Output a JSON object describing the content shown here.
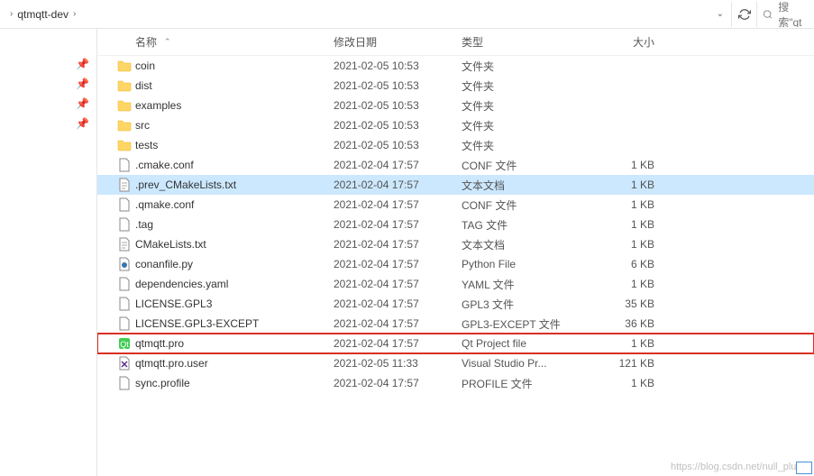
{
  "breadcrumb": {
    "current": "qtmqtt-dev"
  },
  "toolbar": {
    "search_placeholder": "搜索\"qt"
  },
  "columns": {
    "name": "名称",
    "date": "修改日期",
    "type": "类型",
    "size": "大小"
  },
  "files": [
    {
      "icon": "folder",
      "name": "coin",
      "date": "2021-02-05 10:53",
      "type": "文件夹",
      "size": ""
    },
    {
      "icon": "folder",
      "name": "dist",
      "date": "2021-02-05 10:53",
      "type": "文件夹",
      "size": ""
    },
    {
      "icon": "folder",
      "name": "examples",
      "date": "2021-02-05 10:53",
      "type": "文件夹",
      "size": ""
    },
    {
      "icon": "folder",
      "name": "src",
      "date": "2021-02-05 10:53",
      "type": "文件夹",
      "size": ""
    },
    {
      "icon": "folder",
      "name": "tests",
      "date": "2021-02-05 10:53",
      "type": "文件夹",
      "size": ""
    },
    {
      "icon": "file",
      "name": ".cmake.conf",
      "date": "2021-02-04 17:57",
      "type": "CONF 文件",
      "size": "1 KB"
    },
    {
      "icon": "text",
      "name": ".prev_CMakeLists.txt",
      "date": "2021-02-04 17:57",
      "type": "文本文档",
      "size": "1 KB",
      "selected": true
    },
    {
      "icon": "file",
      "name": ".qmake.conf",
      "date": "2021-02-04 17:57",
      "type": "CONF 文件",
      "size": "1 KB"
    },
    {
      "icon": "file",
      "name": ".tag",
      "date": "2021-02-04 17:57",
      "type": "TAG 文件",
      "size": "1 KB"
    },
    {
      "icon": "text",
      "name": "CMakeLists.txt",
      "date": "2021-02-04 17:57",
      "type": "文本文档",
      "size": "1 KB"
    },
    {
      "icon": "python",
      "name": "conanfile.py",
      "date": "2021-02-04 17:57",
      "type": "Python File",
      "size": "6 KB"
    },
    {
      "icon": "file",
      "name": "dependencies.yaml",
      "date": "2021-02-04 17:57",
      "type": "YAML 文件",
      "size": "1 KB"
    },
    {
      "icon": "file",
      "name": "LICENSE.GPL3",
      "date": "2021-02-04 17:57",
      "type": "GPL3 文件",
      "size": "35 KB"
    },
    {
      "icon": "file",
      "name": "LICENSE.GPL3-EXCEPT",
      "date": "2021-02-04 17:57",
      "type": "GPL3-EXCEPT 文件",
      "size": "36 KB"
    },
    {
      "icon": "qt",
      "name": "qtmqtt.pro",
      "date": "2021-02-04 17:57",
      "type": "Qt Project file",
      "size": "1 KB",
      "highlighted": true
    },
    {
      "icon": "vs",
      "name": "qtmqtt.pro.user",
      "date": "2021-02-05 11:33",
      "type": "Visual Studio Pr...",
      "size": "121 KB"
    },
    {
      "icon": "file",
      "name": "sync.profile",
      "date": "2021-02-04 17:57",
      "type": "PROFILE 文件",
      "size": "1 KB"
    }
  ],
  "watermark": "https://blog.csdn.net/null_plus_"
}
